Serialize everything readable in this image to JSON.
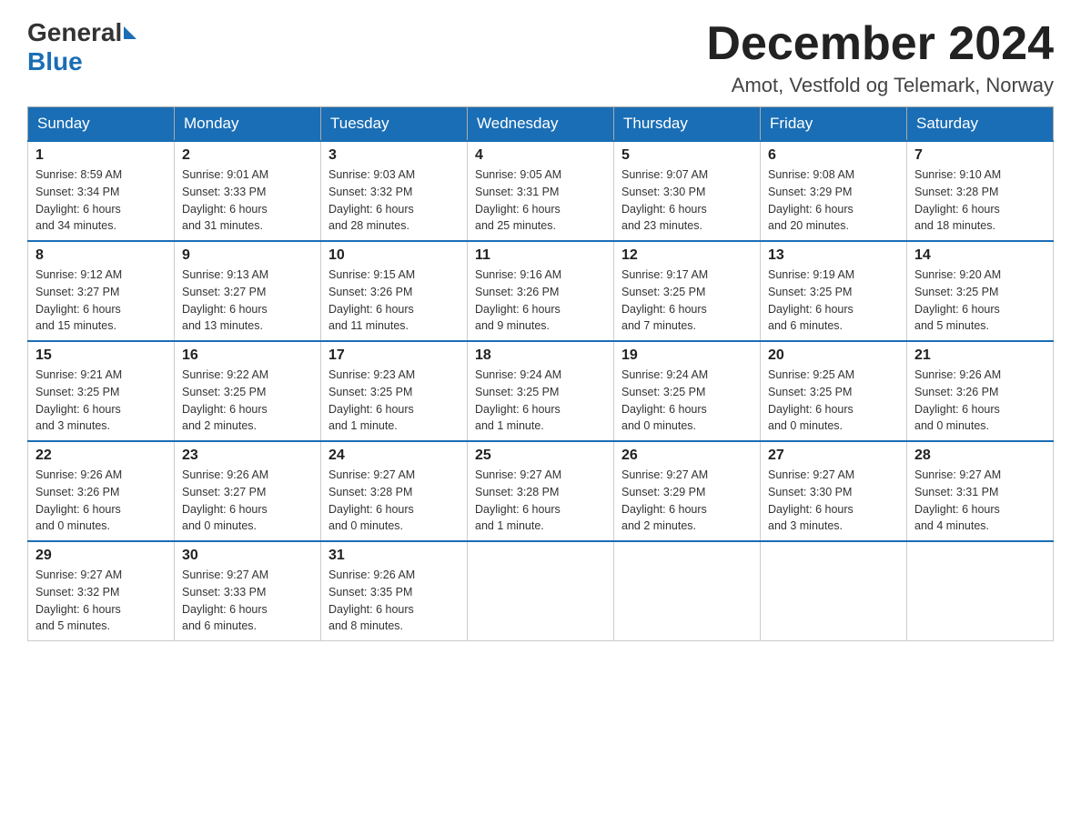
{
  "header": {
    "logo_general": "General",
    "logo_blue": "Blue",
    "month_title": "December 2024",
    "location": "Amot, Vestfold og Telemark, Norway"
  },
  "weekdays": [
    "Sunday",
    "Monday",
    "Tuesday",
    "Wednesday",
    "Thursday",
    "Friday",
    "Saturday"
  ],
  "weeks": [
    [
      {
        "day": "1",
        "sunrise": "Sunrise: 8:59 AM",
        "sunset": "Sunset: 3:34 PM",
        "daylight": "Daylight: 6 hours",
        "daylight2": "and 34 minutes."
      },
      {
        "day": "2",
        "sunrise": "Sunrise: 9:01 AM",
        "sunset": "Sunset: 3:33 PM",
        "daylight": "Daylight: 6 hours",
        "daylight2": "and 31 minutes."
      },
      {
        "day": "3",
        "sunrise": "Sunrise: 9:03 AM",
        "sunset": "Sunset: 3:32 PM",
        "daylight": "Daylight: 6 hours",
        "daylight2": "and 28 minutes."
      },
      {
        "day": "4",
        "sunrise": "Sunrise: 9:05 AM",
        "sunset": "Sunset: 3:31 PM",
        "daylight": "Daylight: 6 hours",
        "daylight2": "and 25 minutes."
      },
      {
        "day": "5",
        "sunrise": "Sunrise: 9:07 AM",
        "sunset": "Sunset: 3:30 PM",
        "daylight": "Daylight: 6 hours",
        "daylight2": "and 23 minutes."
      },
      {
        "day": "6",
        "sunrise": "Sunrise: 9:08 AM",
        "sunset": "Sunset: 3:29 PM",
        "daylight": "Daylight: 6 hours",
        "daylight2": "and 20 minutes."
      },
      {
        "day": "7",
        "sunrise": "Sunrise: 9:10 AM",
        "sunset": "Sunset: 3:28 PM",
        "daylight": "Daylight: 6 hours",
        "daylight2": "and 18 minutes."
      }
    ],
    [
      {
        "day": "8",
        "sunrise": "Sunrise: 9:12 AM",
        "sunset": "Sunset: 3:27 PM",
        "daylight": "Daylight: 6 hours",
        "daylight2": "and 15 minutes."
      },
      {
        "day": "9",
        "sunrise": "Sunrise: 9:13 AM",
        "sunset": "Sunset: 3:27 PM",
        "daylight": "Daylight: 6 hours",
        "daylight2": "and 13 minutes."
      },
      {
        "day": "10",
        "sunrise": "Sunrise: 9:15 AM",
        "sunset": "Sunset: 3:26 PM",
        "daylight": "Daylight: 6 hours",
        "daylight2": "and 11 minutes."
      },
      {
        "day": "11",
        "sunrise": "Sunrise: 9:16 AM",
        "sunset": "Sunset: 3:26 PM",
        "daylight": "Daylight: 6 hours",
        "daylight2": "and 9 minutes."
      },
      {
        "day": "12",
        "sunrise": "Sunrise: 9:17 AM",
        "sunset": "Sunset: 3:25 PM",
        "daylight": "Daylight: 6 hours",
        "daylight2": "and 7 minutes."
      },
      {
        "day": "13",
        "sunrise": "Sunrise: 9:19 AM",
        "sunset": "Sunset: 3:25 PM",
        "daylight": "Daylight: 6 hours",
        "daylight2": "and 6 minutes."
      },
      {
        "day": "14",
        "sunrise": "Sunrise: 9:20 AM",
        "sunset": "Sunset: 3:25 PM",
        "daylight": "Daylight: 6 hours",
        "daylight2": "and 5 minutes."
      }
    ],
    [
      {
        "day": "15",
        "sunrise": "Sunrise: 9:21 AM",
        "sunset": "Sunset: 3:25 PM",
        "daylight": "Daylight: 6 hours",
        "daylight2": "and 3 minutes."
      },
      {
        "day": "16",
        "sunrise": "Sunrise: 9:22 AM",
        "sunset": "Sunset: 3:25 PM",
        "daylight": "Daylight: 6 hours",
        "daylight2": "and 2 minutes."
      },
      {
        "day": "17",
        "sunrise": "Sunrise: 9:23 AM",
        "sunset": "Sunset: 3:25 PM",
        "daylight": "Daylight: 6 hours",
        "daylight2": "and 1 minute."
      },
      {
        "day": "18",
        "sunrise": "Sunrise: 9:24 AM",
        "sunset": "Sunset: 3:25 PM",
        "daylight": "Daylight: 6 hours",
        "daylight2": "and 1 minute."
      },
      {
        "day": "19",
        "sunrise": "Sunrise: 9:24 AM",
        "sunset": "Sunset: 3:25 PM",
        "daylight": "Daylight: 6 hours",
        "daylight2": "and 0 minutes."
      },
      {
        "day": "20",
        "sunrise": "Sunrise: 9:25 AM",
        "sunset": "Sunset: 3:25 PM",
        "daylight": "Daylight: 6 hours",
        "daylight2": "and 0 minutes."
      },
      {
        "day": "21",
        "sunrise": "Sunrise: 9:26 AM",
        "sunset": "Sunset: 3:26 PM",
        "daylight": "Daylight: 6 hours",
        "daylight2": "and 0 minutes."
      }
    ],
    [
      {
        "day": "22",
        "sunrise": "Sunrise: 9:26 AM",
        "sunset": "Sunset: 3:26 PM",
        "daylight": "Daylight: 6 hours",
        "daylight2": "and 0 minutes."
      },
      {
        "day": "23",
        "sunrise": "Sunrise: 9:26 AM",
        "sunset": "Sunset: 3:27 PM",
        "daylight": "Daylight: 6 hours",
        "daylight2": "and 0 minutes."
      },
      {
        "day": "24",
        "sunrise": "Sunrise: 9:27 AM",
        "sunset": "Sunset: 3:28 PM",
        "daylight": "Daylight: 6 hours",
        "daylight2": "and 0 minutes."
      },
      {
        "day": "25",
        "sunrise": "Sunrise: 9:27 AM",
        "sunset": "Sunset: 3:28 PM",
        "daylight": "Daylight: 6 hours",
        "daylight2": "and 1 minute."
      },
      {
        "day": "26",
        "sunrise": "Sunrise: 9:27 AM",
        "sunset": "Sunset: 3:29 PM",
        "daylight": "Daylight: 6 hours",
        "daylight2": "and 2 minutes."
      },
      {
        "day": "27",
        "sunrise": "Sunrise: 9:27 AM",
        "sunset": "Sunset: 3:30 PM",
        "daylight": "Daylight: 6 hours",
        "daylight2": "and 3 minutes."
      },
      {
        "day": "28",
        "sunrise": "Sunrise: 9:27 AM",
        "sunset": "Sunset: 3:31 PM",
        "daylight": "Daylight: 6 hours",
        "daylight2": "and 4 minutes."
      }
    ],
    [
      {
        "day": "29",
        "sunrise": "Sunrise: 9:27 AM",
        "sunset": "Sunset: 3:32 PM",
        "daylight": "Daylight: 6 hours",
        "daylight2": "and 5 minutes."
      },
      {
        "day": "30",
        "sunrise": "Sunrise: 9:27 AM",
        "sunset": "Sunset: 3:33 PM",
        "daylight": "Daylight: 6 hours",
        "daylight2": "and 6 minutes."
      },
      {
        "day": "31",
        "sunrise": "Sunrise: 9:26 AM",
        "sunset": "Sunset: 3:35 PM",
        "daylight": "Daylight: 6 hours",
        "daylight2": "and 8 minutes."
      },
      {
        "day": "",
        "sunrise": "",
        "sunset": "",
        "daylight": "",
        "daylight2": ""
      },
      {
        "day": "",
        "sunrise": "",
        "sunset": "",
        "daylight": "",
        "daylight2": ""
      },
      {
        "day": "",
        "sunrise": "",
        "sunset": "",
        "daylight": "",
        "daylight2": ""
      },
      {
        "day": "",
        "sunrise": "",
        "sunset": "",
        "daylight": "",
        "daylight2": ""
      }
    ]
  ]
}
